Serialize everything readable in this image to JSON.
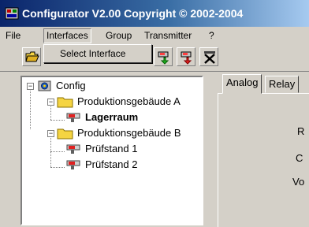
{
  "window": {
    "title": "Configurator  V2.00 Copyright © 2002-2004",
    "icon": "app-icon"
  },
  "menubar": {
    "items": [
      {
        "label": "File"
      },
      {
        "label": "Interfaces"
      },
      {
        "label": "Group"
      },
      {
        "label": "Transmitter"
      },
      {
        "label": "?"
      }
    ]
  },
  "dropdown": {
    "items": [
      {
        "label": "Select Interface"
      }
    ]
  },
  "toolbar": {
    "buttons": [
      {
        "icon": "open-folder-icon"
      },
      {
        "icon": "add-transmitter-icon"
      },
      {
        "icon": "remove-transmitter-icon"
      },
      {
        "icon": "delete-icon"
      }
    ]
  },
  "tree": {
    "root": {
      "label": "Config",
      "expander": "−"
    },
    "groups": [
      {
        "label": "Produktionsgebäude A",
        "expander": "−",
        "children": [
          {
            "label": "Lagerraum",
            "selected": true
          }
        ]
      },
      {
        "label": "Produktionsgebäude B",
        "expander": "−",
        "children": [
          {
            "label": "Prüfstand 1"
          },
          {
            "label": "Prüfstand 2"
          }
        ]
      }
    ]
  },
  "tabs": [
    {
      "label": "Analog",
      "active": true
    },
    {
      "label": "Relay"
    }
  ],
  "tab_page": {
    "clipped_labels": [
      "R",
      "C",
      "Vo"
    ]
  },
  "colors": {
    "title_gradient_start": "#0a246a",
    "title_gradient_end": "#a6caf0",
    "face": "#d4d0c8",
    "folder": "#f5d442"
  }
}
